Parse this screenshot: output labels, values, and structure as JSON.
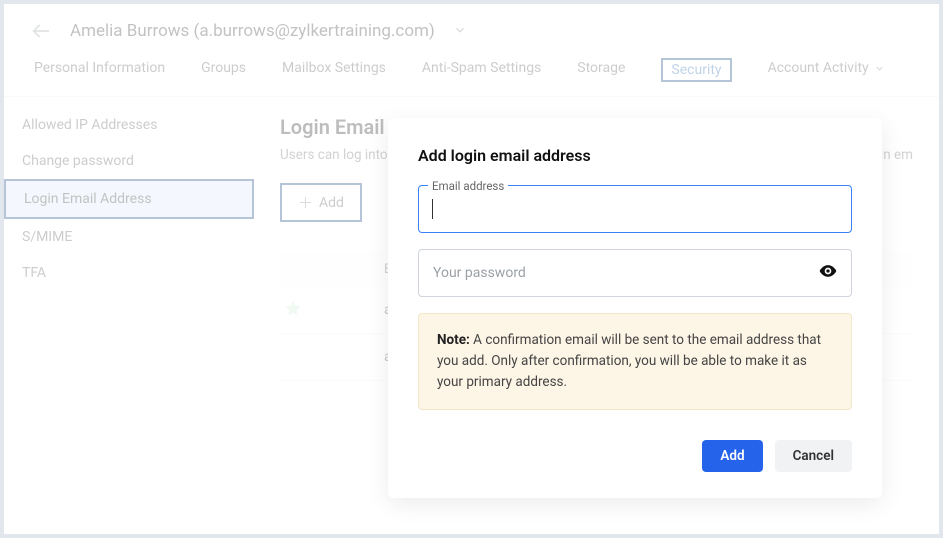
{
  "header": {
    "user": "Amelia Burrows (a.burrows@zylkertraining.com)"
  },
  "tabs": [
    "Personal Information",
    "Groups",
    "Mailbox Settings",
    "Anti-Spam Settings",
    "Storage",
    "Security",
    "Account Activity"
  ],
  "sidebar": {
    "items": [
      "Allowed IP Addresses",
      "Change password",
      "Login Email Address",
      "S/MIME",
      "TFA"
    ]
  },
  "main": {
    "title": "Login Email",
    "description": "Users can log into",
    "description_tail": "e login em",
    "add_label": "Add",
    "table_header": "E",
    "rows": [
      "a",
      "a"
    ]
  },
  "modal": {
    "title": "Add login email address",
    "email_label": "Email address",
    "password_placeholder": "Your password",
    "note_label": "Note:",
    "note_text": "A confirmation email will be sent to the email address that you add. Only after confirmation, you will be able to make it as your primary address.",
    "add": "Add",
    "cancel": "Cancel"
  }
}
